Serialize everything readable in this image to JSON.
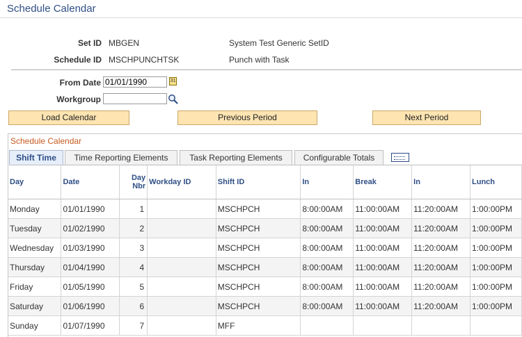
{
  "page": {
    "title": "Schedule Calendar"
  },
  "header": {
    "setid_label": "Set ID",
    "setid_value": "MBGEN",
    "setid_desc": "System Test Generic SetID",
    "schedid_label": "Schedule ID",
    "schedid_value": "MSCHPUNCHTSK",
    "schedid_desc": "Punch with Task"
  },
  "form": {
    "from_date_label": "From Date",
    "from_date_value": "01/01/1990",
    "workgroup_label": "Workgroup",
    "workgroup_value": ""
  },
  "buttons": {
    "load": "Load Calendar",
    "previous": "Previous Period",
    "next": "Next Period"
  },
  "grid": {
    "title": "Schedule Calendar",
    "tabs": [
      {
        "label": "Shift Time",
        "active": true
      },
      {
        "label": "Time Reporting Elements"
      },
      {
        "label": "Task Reporting Elements"
      },
      {
        "label": "Configurable Totals"
      }
    ],
    "columns": [
      "Day",
      "Date",
      "Day Nbr",
      "Workday ID",
      "Shift ID",
      "In",
      "Break",
      "In",
      "Lunch"
    ],
    "rows": [
      [
        "Monday",
        "01/01/1990",
        "1",
        "",
        "MSCHPCH",
        "8:00:00AM",
        "11:00:00AM",
        "11:20:00AM",
        "1:00:00PM"
      ],
      [
        "Tuesday",
        "01/02/1990",
        "2",
        "",
        "MSCHPCH",
        "8:00:00AM",
        "11:00:00AM",
        "11:20:00AM",
        "1:00:00PM"
      ],
      [
        "Wednesday",
        "01/03/1990",
        "3",
        "",
        "MSCHPCH",
        "8:00:00AM",
        "11:00:00AM",
        "11:20:00AM",
        "1:00:00PM"
      ],
      [
        "Thursday",
        "01/04/1990",
        "4",
        "",
        "MSCHPCH",
        "8:00:00AM",
        "11:00:00AM",
        "11:20:00AM",
        "1:00:00PM"
      ],
      [
        "Friday",
        "01/05/1990",
        "5",
        "",
        "MSCHPCH",
        "8:00:00AM",
        "11:00:00AM",
        "11:20:00AM",
        "1:00:00PM"
      ],
      [
        "Saturday",
        "01/06/1990",
        "6",
        "",
        "MSCHPCH",
        "8:00:00AM",
        "11:00:00AM",
        "11:20:00AM",
        "1:00:00PM"
      ],
      [
        "Sunday",
        "01/07/1990",
        "7",
        "",
        "MFF",
        "",
        "",
        "",
        ""
      ]
    ]
  }
}
